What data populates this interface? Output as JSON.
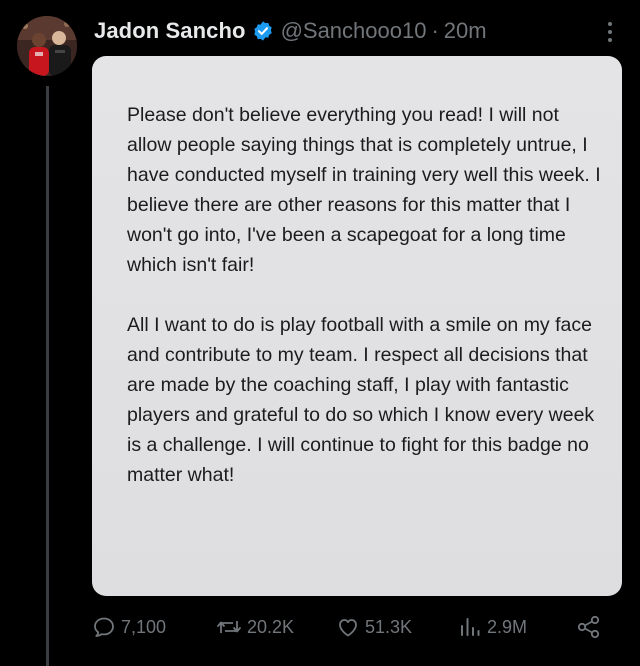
{
  "author": {
    "display_name": "Jadon Sancho",
    "handle": "@Sanchooo10",
    "separator": "·",
    "time": "20m",
    "verified": true,
    "avatar_icon": "profile-photo"
  },
  "media": {
    "paragraphs": [
      "Please don't believe everything you read! I will not allow people saying things that is completely untrue, I have conducted myself in training very well this week. I believe there are other reasons for this matter that I won't go into, I've been a scapegoat for a long time which isn't fair!",
      "All I want to do is play football with a smile on my face and contribute to my team. I respect all decisions that are made by the coaching staff, I play with fantastic players and grateful to do so which I know every week is a challenge. I will continue to fight for this badge no matter what!"
    ]
  },
  "actions": {
    "replies": "7,100",
    "reposts": "20.2K",
    "likes": "51.3K",
    "views": "2.9M"
  },
  "colors": {
    "background": "#000000",
    "text_primary": "#e7e9ea",
    "text_secondary": "#71767b",
    "verified_blue": "#1d9bf0",
    "card_background": "#e2e2e4",
    "card_text": "#1c1c1e"
  }
}
